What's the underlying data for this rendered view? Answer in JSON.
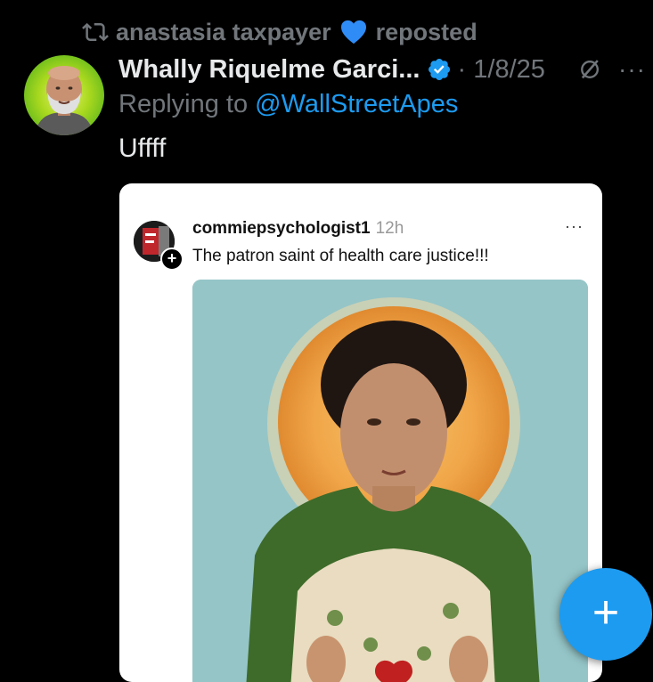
{
  "repost": {
    "user": "anastasia taxpayer",
    "action": "reposted"
  },
  "post": {
    "author": "Whally Riquelme Garci...",
    "date": "· 1/8/25",
    "reply_prefix": "Replying to",
    "reply_handle": "@WallStreetApes",
    "text": "Uffff",
    "more": "···"
  },
  "embedded": {
    "username": "commiepsychologist1",
    "time": "12h",
    "text": "The patron saint of health care justice!!!",
    "more": "···",
    "badge": "+"
  },
  "fab": {
    "label": "+"
  },
  "icons": {
    "repost": "repost-icon",
    "heart": "blue-heart-icon",
    "verified": "verified-badge-icon",
    "grok": "grok-icon",
    "more": "more-icon",
    "compose": "plus-icon"
  },
  "colors": {
    "accent": "#1d9bf0",
    "muted": "#71767b",
    "text": "#e7e9ea",
    "background": "#000000"
  }
}
